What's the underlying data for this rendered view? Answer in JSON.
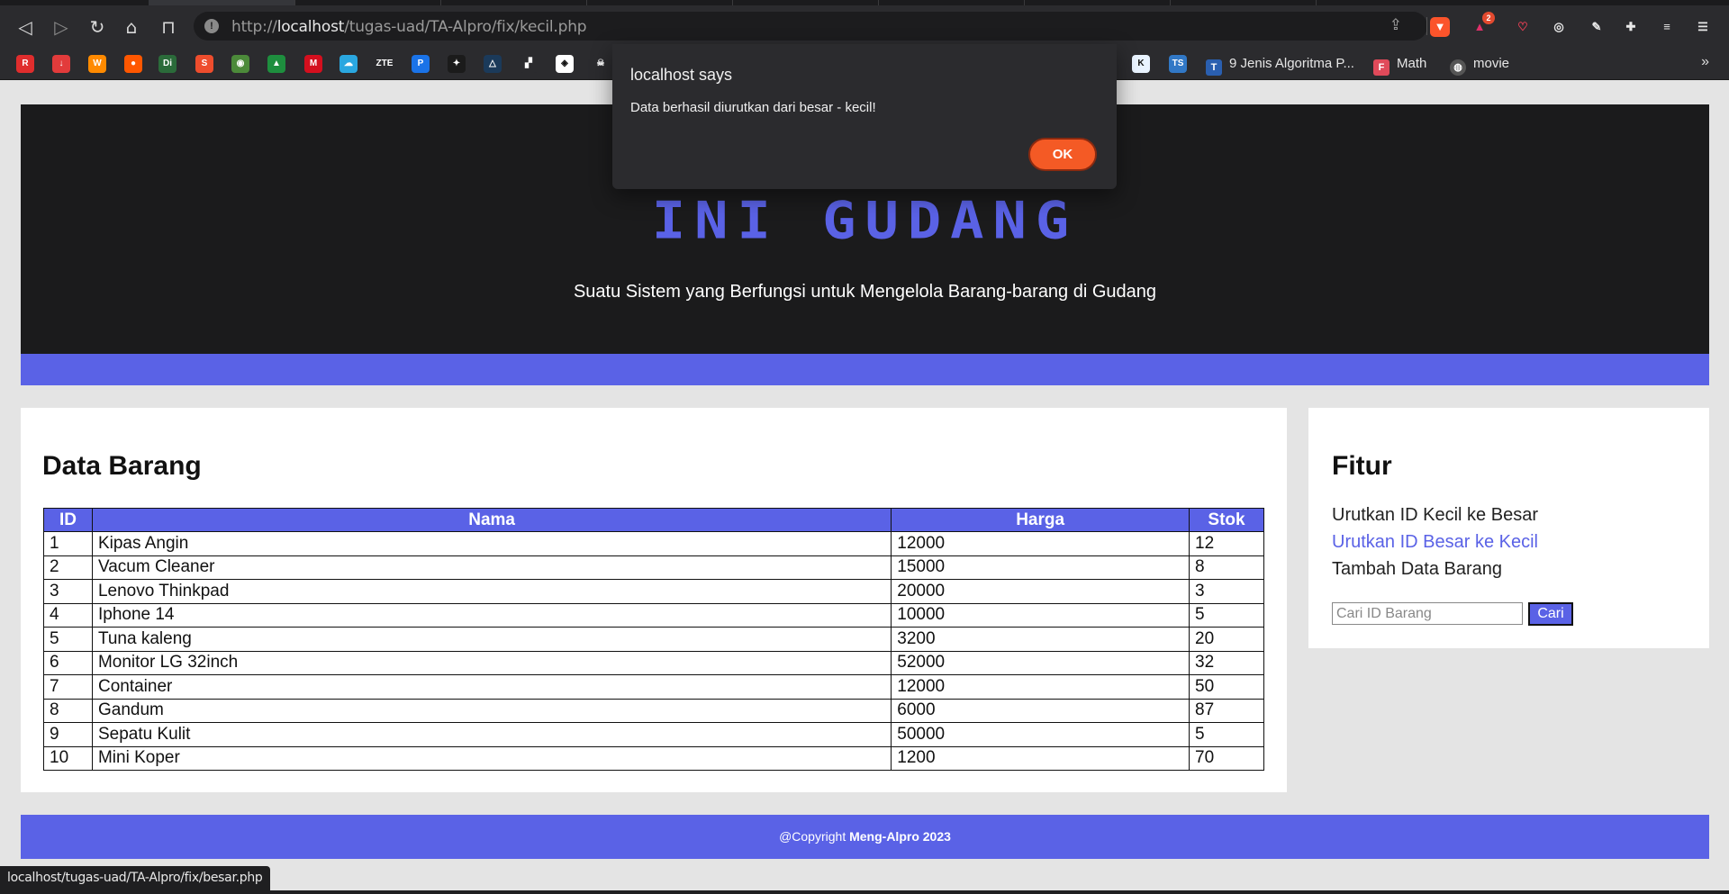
{
  "browser": {
    "url_host": "localhost",
    "url_path": "/tugas-uad/TA-Alpro/fix/kecil.php",
    "url_scheme": "http://",
    "extension_badge": "2",
    "bookmarks": [
      {
        "label": "9 Jenis Algoritma P...",
        "icon": "T",
        "color": "#2a5fb0"
      },
      {
        "label": "Math",
        "icon": "F",
        "color": "#e04a5a"
      },
      {
        "label": "movie",
        "icon": "globe",
        "color": "#555555"
      }
    ],
    "bookmark_icons": [
      {
        "name": "bookmark-icon-1",
        "color": "#e02d2d",
        "glyph": "R"
      },
      {
        "name": "bookmark-icon-2",
        "color": "#e23b3b",
        "glyph": "↓"
      },
      {
        "name": "bookmark-icon-3",
        "color": "#ff8a00",
        "glyph": "W"
      },
      {
        "name": "bookmark-icon-4",
        "color": "#ff5700",
        "glyph": "●"
      },
      {
        "name": "bookmark-icon-5",
        "color": "#2b6b3a",
        "glyph": "Di"
      },
      {
        "name": "bookmark-icon-6",
        "color": "#ee4d2d",
        "glyph": "S"
      },
      {
        "name": "bookmark-icon-7",
        "color": "#4c8a3a",
        "glyph": "◉"
      },
      {
        "name": "bookmark-icon-8",
        "color": "#1e8e3e",
        "glyph": "▲"
      },
      {
        "name": "bookmark-icon-9",
        "color": "#d40f1e",
        "glyph": "M"
      },
      {
        "name": "bookmark-icon-10",
        "color": "#2aa7e0",
        "glyph": "☁"
      },
      {
        "name": "bookmark-icon-11",
        "color": "#2b2b2e",
        "glyph": "ZTE"
      },
      {
        "name": "bookmark-icon-12",
        "color": "#1a73e8",
        "glyph": "P"
      },
      {
        "name": "bookmark-icon-13",
        "color": "#1b1b1b",
        "glyph": "✦"
      },
      {
        "name": "bookmark-icon-14",
        "color": "#1b3a5a",
        "glyph": "△"
      },
      {
        "name": "bookmark-icon-15",
        "color": "#2b2b2e",
        "glyph": "▞"
      },
      {
        "name": "bookmark-icon-16",
        "color": "#ffffff",
        "glyph": "◈"
      },
      {
        "name": "bookmark-icon-17",
        "color": "#2b2b2e",
        "glyph": "☠"
      },
      {
        "name": "bookmark-icon-18",
        "color": "#e9f3ff",
        "glyph": "K"
      },
      {
        "name": "bookmark-icon-19",
        "color": "#3178c6",
        "glyph": "TS"
      }
    ],
    "status_url": "localhost/tugas-uad/TA-Alpro/fix/besar.php"
  },
  "dialog": {
    "title": "localhost says",
    "message": "Data berhasil diurutkan dari besar - kecil!",
    "ok_label": "OK"
  },
  "hero": {
    "title": "INI GUDANG",
    "subtitle": "Suatu Sistem yang Berfungsi untuk Mengelola Barang-barang di Gudang"
  },
  "main": {
    "heading": "Data Barang",
    "columns": [
      "ID",
      "Nama",
      "Harga",
      "Stok"
    ],
    "rows": [
      [
        "1",
        "Kipas Angin",
        "12000",
        "12"
      ],
      [
        "2",
        "Vacum Cleaner",
        "15000",
        "8"
      ],
      [
        "3",
        "Lenovo Thinkpad",
        "20000",
        "3"
      ],
      [
        "4",
        "Iphone 14",
        "10000",
        "5"
      ],
      [
        "5",
        "Tuna kaleng",
        "3200",
        "20"
      ],
      [
        "6",
        "Monitor LG 32inch",
        "52000",
        "32"
      ],
      [
        "7",
        "Container",
        "12000",
        "50"
      ],
      [
        "8",
        "Gandum",
        "6000",
        "87"
      ],
      [
        "9",
        "Sepatu Kulit",
        "50000",
        "5"
      ],
      [
        "10",
        "Mini Koper",
        "1200",
        "70"
      ]
    ]
  },
  "side": {
    "heading": "Fitur",
    "links": [
      "Urutkan ID Kecil ke Besar",
      "Urutkan ID Besar ke Kecil",
      "Tambah Data Barang"
    ],
    "search_placeholder": "Cari ID Barang",
    "search_button": "Cari"
  },
  "footer": {
    "prefix": "@Copyright ",
    "brand": "Meng-Alpro 2023"
  },
  "colors": {
    "accent": "#5a62e6",
    "hero_bg": "#1b1b1c",
    "ok_button": "#f45a25"
  }
}
